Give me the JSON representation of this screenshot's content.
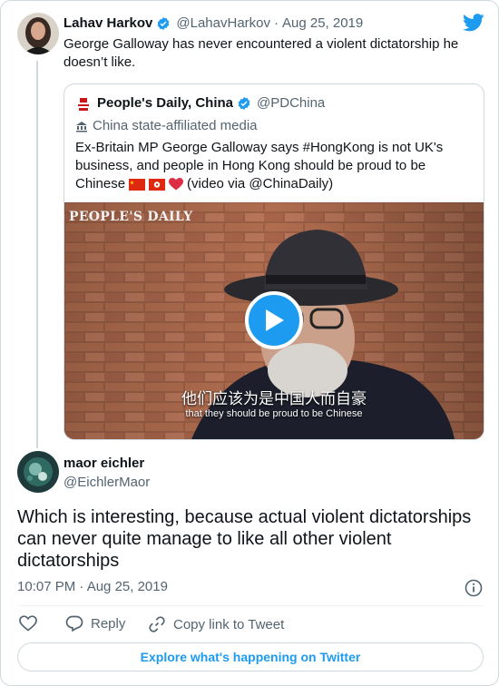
{
  "tweet": {
    "author_name": "Lahav Harkov",
    "author_handle": "@LahavHarkov",
    "separator": "·",
    "date": "Aug 25, 2019",
    "text": "George Galloway has never encountered a violent dictatorship he doesn’t like."
  },
  "quote": {
    "author_name": "People's Daily, China",
    "author_handle": "@PDChina",
    "label": "China state-affiliated media",
    "text_line1": "Ex-Britain MP George Galloway says #HongKong is not UK's",
    "text_line2": "business, and people in Hong Kong should be proud to be",
    "text_line3_prefix": "Chinese",
    "text_line3_suffix": "(video via @ChinaDaily)",
    "emojis": [
      "flag-cn-icon",
      "flag-hk-icon",
      "red-heart-icon"
    ],
    "video": {
      "watermark": "PEOPLE'S DAILY",
      "subtitle_cn": "他们应该为是中国人而自豪",
      "subtitle_en": "that they should be proud to be Chinese"
    }
  },
  "reply": {
    "author_name": "maor eichler",
    "author_handle": "@EichlerMaor",
    "text_line1": "Which is interesting, because actual violent dictatorships",
    "text_line2": "can never quite manage to like all other violent",
    "text_line3": "dictatorships",
    "timestamp": "10:07 PM · Aug 25, 2019"
  },
  "actions": {
    "reply_label": "Reply",
    "copy_label": "Copy link to Tweet"
  },
  "explore_label": "Explore what's happening on Twitter",
  "colors": {
    "twitter_blue": "#1d9bf0",
    "text_primary": "#0f1419",
    "text_secondary": "#536471",
    "border": "#cfd9de",
    "verified": "#1d9bf0"
  }
}
